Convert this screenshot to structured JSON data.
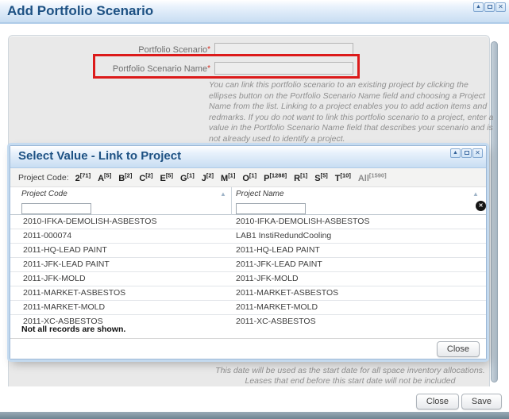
{
  "colors": {
    "accent_red": "#dc1a1a",
    "title_text_blue": "#1d5183",
    "titlebar_blue": "#c8ddf2",
    "footer_strip": "#6e8491"
  },
  "main_dialog": {
    "title": "Add Portfolio Scenario",
    "controls": {
      "collapse_glyph": "▲",
      "close_glyph": "✕"
    },
    "form": {
      "fields": [
        {
          "label": "Portfolio Scenario",
          "required_mark": "*",
          "value": ""
        },
        {
          "label": "Portfolio Scenario Name",
          "required_mark": "*",
          "value": ""
        }
      ],
      "help_text": "You can link this portfolio scenario to an existing project by clicking the ellipses button on the Portfolio Scenario Name field and choosing a Project Name from the list. Linking to a project enables you to add action items and redmarks. If you do not want to link this portfolio scenario to a project, enter a value in the Portfolio Scenario Name field that describes your scenario and is not already used to identify a project."
    },
    "date_note": "This date will be used as the start date for all space inventory allocations. Leases that end before this start date will not be included",
    "footer": {
      "close_label": "Close",
      "save_label": "Save"
    }
  },
  "select_dialog": {
    "title": "Select Value - Link to Project",
    "controls": {
      "collapse_glyph": "▲",
      "close_glyph": "✕"
    },
    "filter_bar": {
      "label": "Project Code:",
      "links": [
        {
          "letter": "2",
          "count": "[71]"
        },
        {
          "letter": "A",
          "count": "[5]"
        },
        {
          "letter": "B",
          "count": "[2]"
        },
        {
          "letter": "C",
          "count": "[2]"
        },
        {
          "letter": "E",
          "count": "[5]"
        },
        {
          "letter": "G",
          "count": "[1]"
        },
        {
          "letter": "J",
          "count": "[2]"
        },
        {
          "letter": "M",
          "count": "[1]"
        },
        {
          "letter": "O",
          "count": "[1]"
        },
        {
          "letter": "P",
          "count": "[1288]"
        },
        {
          "letter": "R",
          "count": "[1]"
        },
        {
          "letter": "S",
          "count": "[5]"
        },
        {
          "letter": "T",
          "count": "[10]"
        },
        {
          "letter": "All",
          "count": "[1590]"
        }
      ]
    },
    "table": {
      "columns": [
        {
          "header": "Project Code",
          "sort_glyph": "▲",
          "filter_value": ""
        },
        {
          "header": "Project Name",
          "sort_glyph": "▲",
          "filter_value": ""
        }
      ],
      "clear_icon_glyph": "✕",
      "rows": [
        [
          "2010-IFKA-DEMOLISH-ASBESTOS",
          "2010-IFKA-DEMOLISH-ASBESTOS"
        ],
        [
          "2011-000074",
          "LAB1 InstiRedundCooling"
        ],
        [
          "2011-HQ-LEAD PAINT",
          "2011-HQ-LEAD PAINT"
        ],
        [
          "2011-JFK-LEAD PAINT",
          "2011-JFK-LEAD PAINT"
        ],
        [
          "2011-JFK-MOLD",
          "2011-JFK-MOLD"
        ],
        [
          "2011-MARKET-ASBESTOS",
          "2011-MARKET-ASBESTOS"
        ],
        [
          "2011-MARKET-MOLD",
          "2011-MARKET-MOLD"
        ],
        [
          "2011-XC-ASBESTOS",
          "2011-XC-ASBESTOS"
        ]
      ],
      "note": "Not all records are shown."
    },
    "footer": {
      "close_label": "Close"
    }
  }
}
